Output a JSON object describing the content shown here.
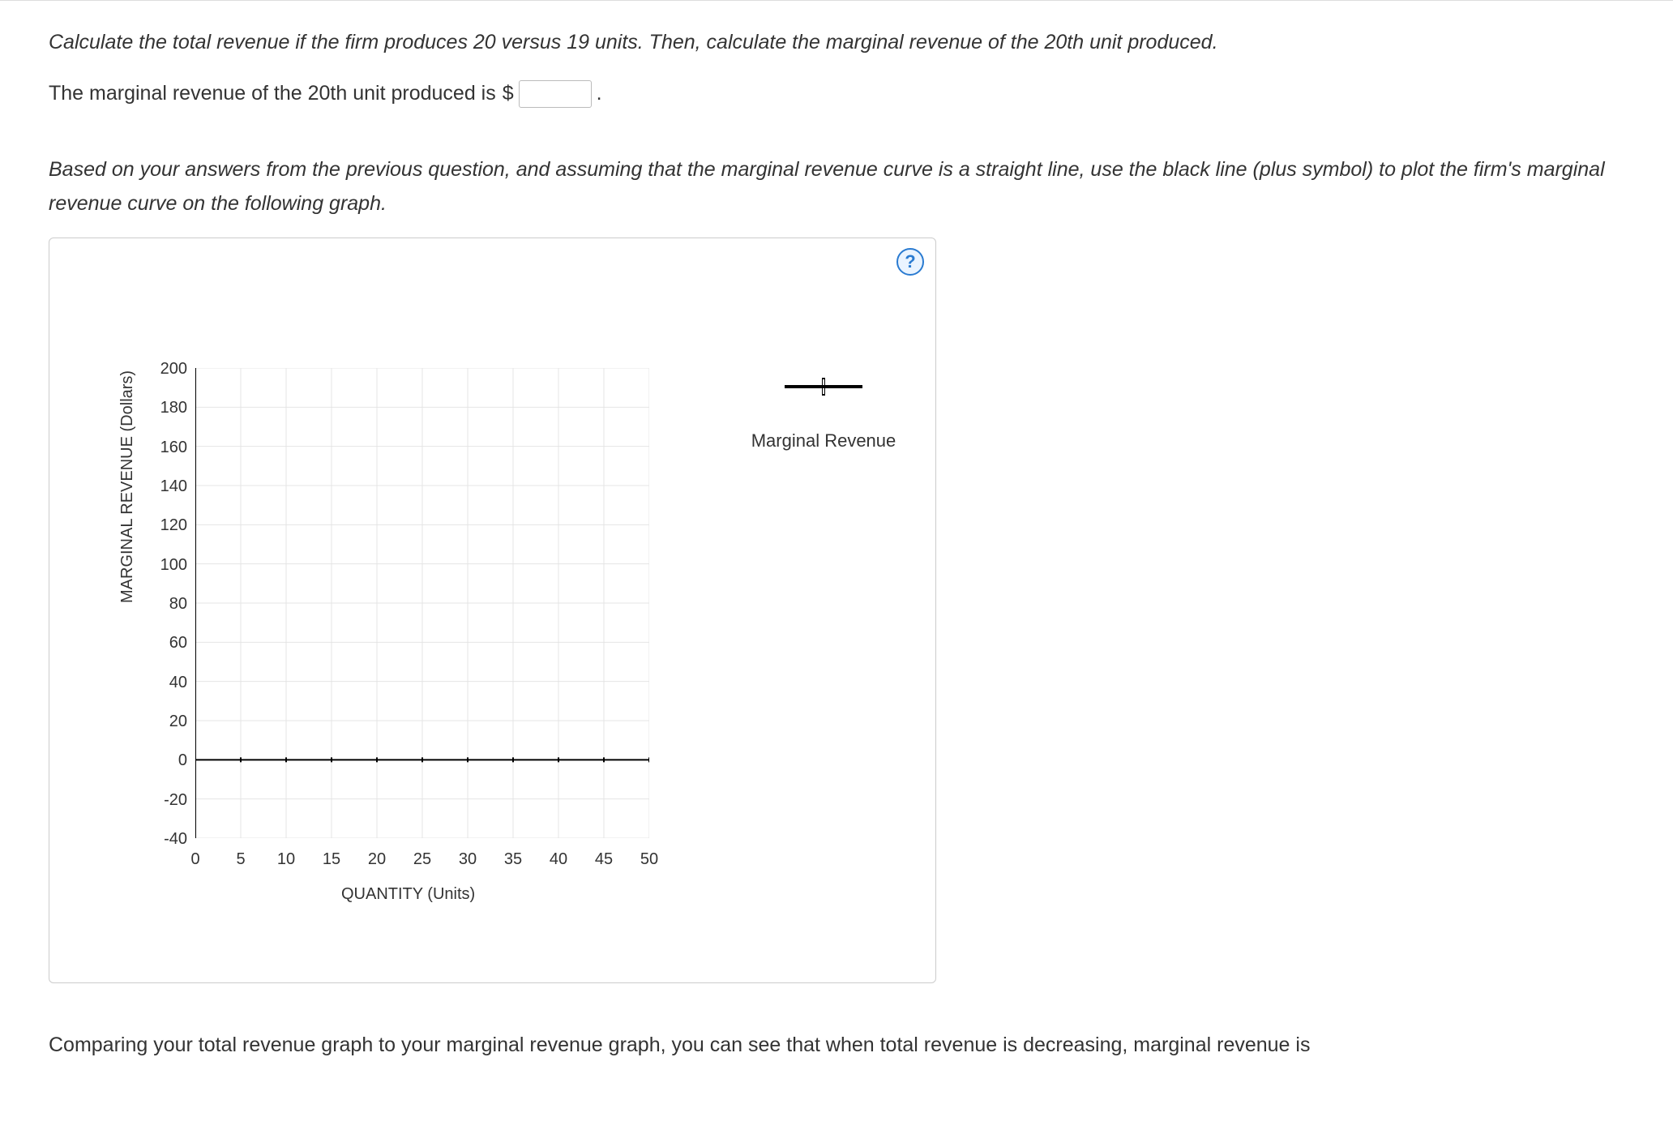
{
  "question": {
    "instruction1": "Calculate the total revenue if the firm produces 20 versus 19 units. Then, calculate the marginal revenue of the 20th unit produced.",
    "answer_prefix": "The marginal revenue of the 20th unit produced is",
    "currency": "$",
    "period": ".",
    "instruction2": "Based on your answers from the previous question, and assuming that the marginal revenue curve is a straight line, use the black line (plus symbol) to plot the firm's marginal revenue curve on the following graph.",
    "bottom_text": "Comparing your total revenue graph to your marginal revenue graph, you can see that when total revenue is decreasing, marginal revenue is"
  },
  "help": {
    "label": "?"
  },
  "legend": {
    "label": "Marginal Revenue"
  },
  "chart_data": {
    "type": "line",
    "title": "",
    "xlabel": "QUANTITY (Units)",
    "ylabel": "MARGINAL REVENUE (Dollars)",
    "xlim": [
      0,
      50
    ],
    "ylim": [
      -40,
      200
    ],
    "x_ticks": [
      0,
      5,
      10,
      15,
      20,
      25,
      30,
      35,
      40,
      45,
      50
    ],
    "y_ticks": [
      -40,
      -20,
      0,
      20,
      40,
      60,
      80,
      100,
      120,
      140,
      160,
      180,
      200
    ],
    "series": [
      {
        "name": "Marginal Revenue",
        "x": [],
        "y": []
      }
    ],
    "grid": true
  }
}
